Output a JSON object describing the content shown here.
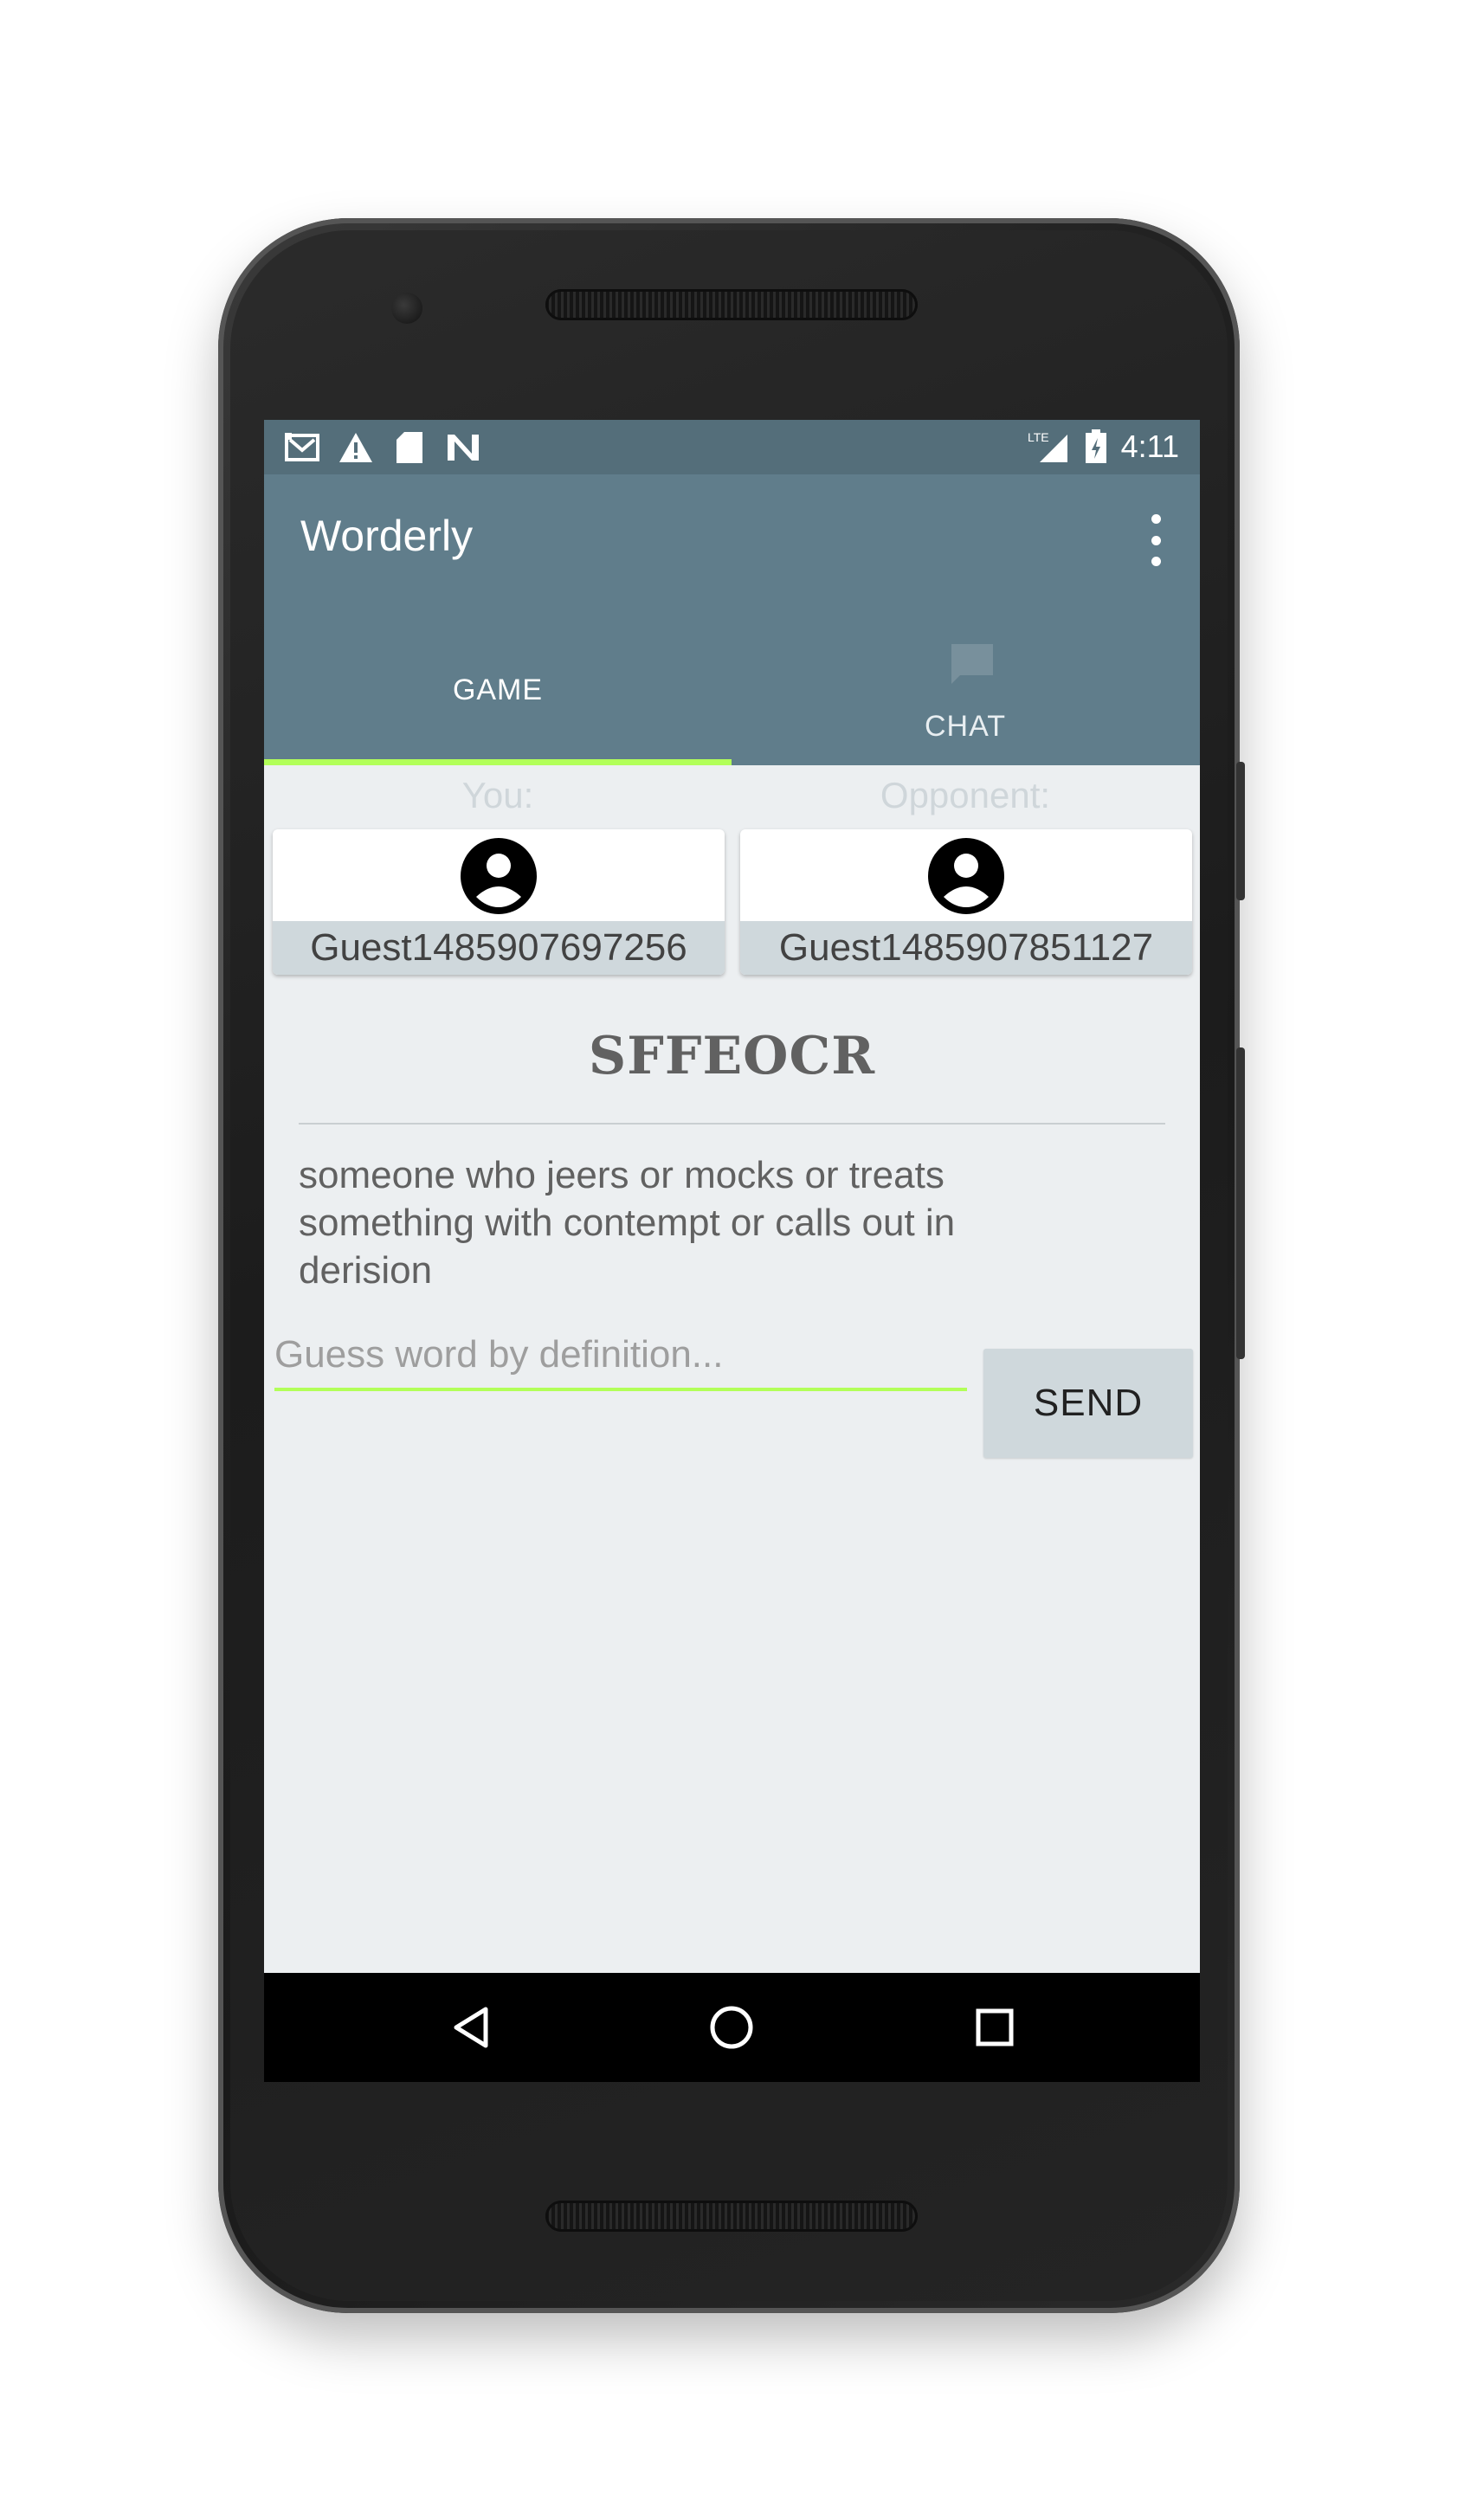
{
  "status_bar": {
    "left_icons": [
      "gmail-icon",
      "warning-icon",
      "sd-card-icon",
      "n-logo-icon"
    ],
    "network": "LTE",
    "time": "4:11"
  },
  "app_bar": {
    "title": "Worderly",
    "menu_icon": "more-vert-icon"
  },
  "tabs": [
    {
      "label": "GAME",
      "selected": true
    },
    {
      "label": "CHAT",
      "selected": false,
      "icon": "chat-icon"
    }
  ],
  "colors": {
    "primary": "#607d8b",
    "primary_dark": "#546e7a",
    "accent": "#b2ff59",
    "background": "#eceff1",
    "card_footer": "#cfd8dc"
  },
  "players": {
    "you": {
      "role_label": "You:",
      "name": "Guest1485907697256",
      "avatar_icon": "account-circle-icon"
    },
    "opponent": {
      "role_label": "Opponent:",
      "name": "Guest1485907851127",
      "avatar_icon": "account-circle-icon"
    }
  },
  "puzzle": {
    "scrambled_word": "SFFEOCR",
    "definition": "someone who jeers or mocks or treats something with contempt or calls out in derision"
  },
  "guess": {
    "placeholder": "Guess word by definition...",
    "value": "",
    "send_label": "SEND"
  },
  "nav_bar": {
    "buttons": [
      "back-icon",
      "home-icon",
      "recents-icon"
    ]
  }
}
